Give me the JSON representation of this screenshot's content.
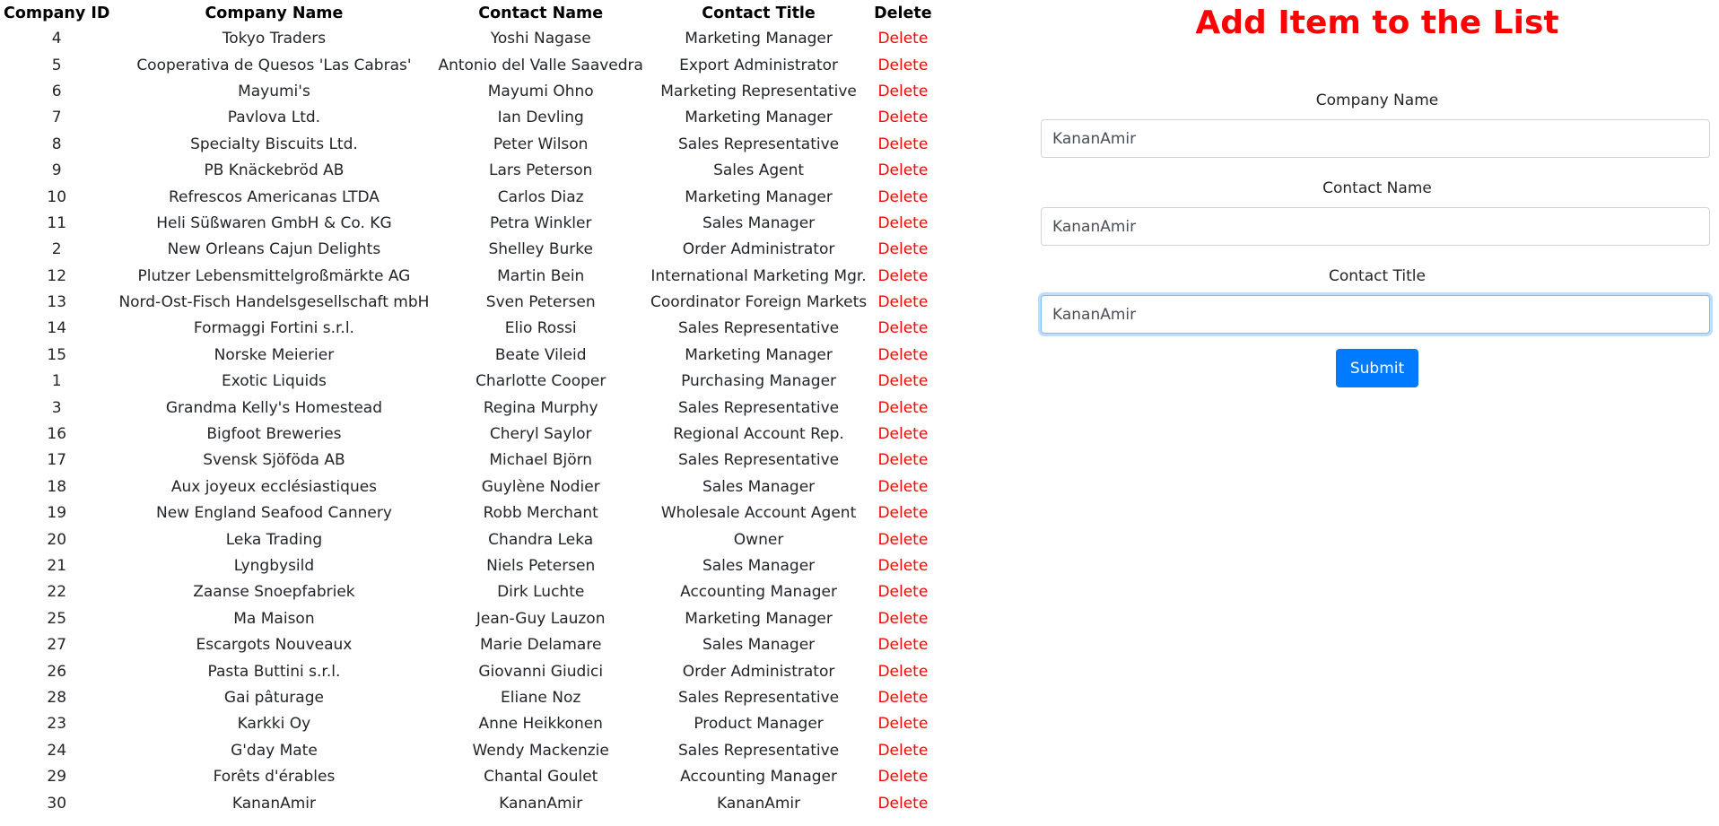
{
  "table": {
    "headers": {
      "id": "Company ID",
      "company": "Company Name",
      "contact": "Contact Name",
      "title": "Contact Title",
      "delete": "Delete"
    },
    "rows": [
      {
        "id": "4",
        "company": "Tokyo Traders",
        "contact": "Yoshi Nagase",
        "title": "Marketing Manager",
        "action": "Delete"
      },
      {
        "id": "5",
        "company": "Cooperativa de Quesos 'Las Cabras'",
        "contact": "Antonio del Valle Saavedra",
        "title": "Export Administrator",
        "action": "Delete"
      },
      {
        "id": "6",
        "company": "Mayumi's",
        "contact": "Mayumi Ohno",
        "title": "Marketing Representative",
        "action": "Delete"
      },
      {
        "id": "7",
        "company": "Pavlova Ltd.",
        "contact": "Ian Devling",
        "title": "Marketing Manager",
        "action": "Delete"
      },
      {
        "id": "8",
        "company": "Specialty Biscuits Ltd.",
        "contact": "Peter Wilson",
        "title": "Sales Representative",
        "action": "Delete"
      },
      {
        "id": "9",
        "company": "PB Knäckebröd AB",
        "contact": "Lars Peterson",
        "title": "Sales Agent",
        "action": "Delete"
      },
      {
        "id": "10",
        "company": "Refrescos Americanas LTDA",
        "contact": "Carlos Diaz",
        "title": "Marketing Manager",
        "action": "Delete"
      },
      {
        "id": "11",
        "company": "Heli Süßwaren GmbH & Co. KG",
        "contact": "Petra Winkler",
        "title": "Sales Manager",
        "action": "Delete"
      },
      {
        "id": "2",
        "company": "New Orleans Cajun Delights",
        "contact": "Shelley Burke",
        "title": "Order Administrator",
        "action": "Delete"
      },
      {
        "id": "12",
        "company": "Plutzer Lebensmittelgroßmärkte AG",
        "contact": "Martin Bein",
        "title": "International Marketing Mgr.",
        "action": "Delete"
      },
      {
        "id": "13",
        "company": "Nord-Ost-Fisch Handelsgesellschaft mbH",
        "contact": "Sven Petersen",
        "title": "Coordinator Foreign Markets",
        "action": "Delete"
      },
      {
        "id": "14",
        "company": "Formaggi Fortini s.r.l.",
        "contact": "Elio Rossi",
        "title": "Sales Representative",
        "action": "Delete"
      },
      {
        "id": "15",
        "company": "Norske Meierier",
        "contact": "Beate Vileid",
        "title": "Marketing Manager",
        "action": "Delete"
      },
      {
        "id": "1",
        "company": "Exotic Liquids",
        "contact": "Charlotte Cooper",
        "title": "Purchasing Manager",
        "action": "Delete"
      },
      {
        "id": "3",
        "company": "Grandma Kelly's Homestead",
        "contact": "Regina Murphy",
        "title": "Sales Representative",
        "action": "Delete"
      },
      {
        "id": "16",
        "company": "Bigfoot Breweries",
        "contact": "Cheryl Saylor",
        "title": "Regional Account Rep.",
        "action": "Delete"
      },
      {
        "id": "17",
        "company": "Svensk Sjöföda AB",
        "contact": "Michael Björn",
        "title": "Sales Representative",
        "action": "Delete"
      },
      {
        "id": "18",
        "company": "Aux joyeux ecclésiastiques",
        "contact": "Guylène Nodier",
        "title": "Sales Manager",
        "action": "Delete"
      },
      {
        "id": "19",
        "company": "New England Seafood Cannery",
        "contact": "Robb Merchant",
        "title": "Wholesale Account Agent",
        "action": "Delete"
      },
      {
        "id": "20",
        "company": "Leka Trading",
        "contact": "Chandra Leka",
        "title": "Owner",
        "action": "Delete"
      },
      {
        "id": "21",
        "company": "Lyngbysild",
        "contact": "Niels Petersen",
        "title": "Sales Manager",
        "action": "Delete"
      },
      {
        "id": "22",
        "company": "Zaanse Snoepfabriek",
        "contact": "Dirk Luchte",
        "title": "Accounting Manager",
        "action": "Delete"
      },
      {
        "id": "25",
        "company": "Ma Maison",
        "contact": "Jean-Guy Lauzon",
        "title": "Marketing Manager",
        "action": "Delete"
      },
      {
        "id": "27",
        "company": "Escargots Nouveaux",
        "contact": "Marie Delamare",
        "title": "Sales Manager",
        "action": "Delete"
      },
      {
        "id": "26",
        "company": "Pasta Buttini s.r.l.",
        "contact": "Giovanni Giudici",
        "title": "Order Administrator",
        "action": "Delete"
      },
      {
        "id": "28",
        "company": "Gai pâturage",
        "contact": "Eliane Noz",
        "title": "Sales Representative",
        "action": "Delete"
      },
      {
        "id": "23",
        "company": "Karkki Oy",
        "contact": "Anne Heikkonen",
        "title": "Product Manager",
        "action": "Delete"
      },
      {
        "id": "24",
        "company": "G'day Mate",
        "contact": "Wendy Mackenzie",
        "title": "Sales Representative",
        "action": "Delete"
      },
      {
        "id": "29",
        "company": "Forêts d'érables",
        "contact": "Chantal Goulet",
        "title": "Accounting Manager",
        "action": "Delete"
      },
      {
        "id": "30",
        "company": "KananAmir",
        "contact": "KananAmir",
        "title": "KananAmir",
        "action": "Delete"
      }
    ]
  },
  "form": {
    "title": "Add Item to the List",
    "company_label": "Company Name",
    "company_value": "KananAmir",
    "contact_label": "Contact Name",
    "contact_value": "KananAmir",
    "title_label": "Contact Title",
    "title_value": "KananAmir",
    "submit_label": "Submit"
  },
  "colors": {
    "accent_red": "#ff0000",
    "button_blue": "#007bff"
  }
}
